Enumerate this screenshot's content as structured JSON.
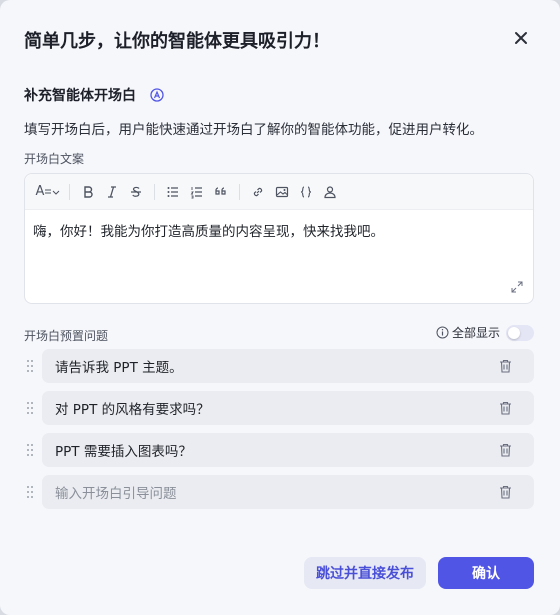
{
  "dialog": {
    "title": "简单几步，让你的智能体更具吸引力！",
    "section_title": "补充智能体开场白",
    "description": "填写开场白后，用户能快速通过开场白了解你的智能体功能，促进用户转化。",
    "opening_label": "开场白文案",
    "toolbar": {
      "font_size_label": "A",
      "items": [
        "font-size",
        "bold",
        "italic",
        "strikethrough",
        "bullet-list",
        "numbered-list",
        "quote",
        "link",
        "image",
        "code",
        "user"
      ]
    },
    "opening_text": "嗨，你好！我能为你打造高质量的内容呈现，快来找我吧。",
    "preset_label": "开场白预置问题",
    "show_all_label": "全部显示",
    "show_all_on": false,
    "questions": [
      {
        "text": "请告诉我 PPT 主题。"
      },
      {
        "text": "对 PPT 的风格有要求吗？"
      },
      {
        "text": "PPT 需要插入图表吗？"
      }
    ],
    "new_question_placeholder": "输入开场白引导问题",
    "skip_button": "跳过并直接发布",
    "confirm_button": "确认"
  },
  "colors": {
    "accent": "#5155e6",
    "accent_soft": "#e6e8f4",
    "background": "#f6f7fb"
  }
}
